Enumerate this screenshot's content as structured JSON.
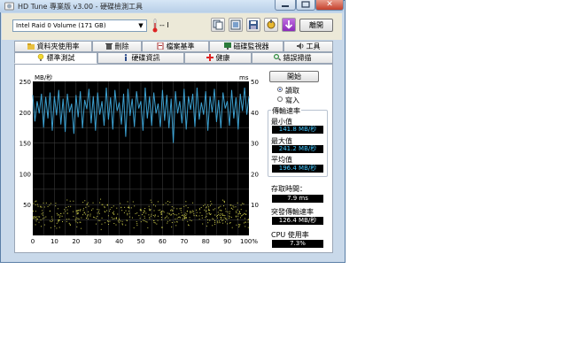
{
  "window": {
    "title": "HD Tune 專業版 v3.00 - 硬碟檢測工具",
    "close_symbol": "✕"
  },
  "toolbar": {
    "drive": "Intel   Raid 0 Volume  (171 GB)",
    "temperature": "-- I",
    "exit_label": "離開"
  },
  "tabs_row1": [
    {
      "label": "資料夾使用率",
      "icon": "folder-icon"
    },
    {
      "label": "刪除",
      "icon": "trash-icon"
    },
    {
      "label": "檔案基準",
      "icon": "file-benchmark-icon"
    },
    {
      "label": "磁碟監視器",
      "icon": "monitor-icon"
    },
    {
      "label": "工具",
      "icon": "speaker-icon"
    }
  ],
  "tabs_row2": [
    {
      "label": "標準測試",
      "icon": "bulb-icon"
    },
    {
      "label": "硬碟資訊",
      "icon": "info-icon"
    },
    {
      "label": "健康",
      "icon": "health-cross-icon"
    },
    {
      "label": "錯誤掃描",
      "icon": "magnifier-icon"
    }
  ],
  "controls": {
    "start_label": "開始",
    "read_label": "讀取",
    "write_label": "寫入",
    "selected": "read"
  },
  "results": {
    "group_title": "傳輸速率",
    "min_label": "最小值",
    "min_value": "141.8 MB/秒",
    "max_label": "最大值",
    "max_value": "241.2 MB/秒",
    "avg_label": "平均值",
    "avg_value": "196.4 MB/秒",
    "access_label": "存取時間：",
    "access_value": "7.9 ms",
    "burst_label": "突發傳輸速率",
    "burst_value": "126.4 MB/秒",
    "cpu_label": "CPU 使用率",
    "cpu_value": "7.3%"
  },
  "colors": {
    "plot_background": "#000000",
    "transfer_line": "#3ca0d0",
    "access_points": "#c8c84a",
    "grid": "#3a3a3a"
  },
  "chart_data": {
    "type": "line",
    "ylabel": "MB/秒",
    "y2label": "ms",
    "ylim": [
      0,
      250
    ],
    "y2lim": [
      0,
      50
    ],
    "yticks": [
      50,
      100,
      150,
      200,
      250
    ],
    "y2ticks": [
      10,
      20,
      30,
      40,
      50
    ],
    "xticks": [
      "0",
      "10",
      "20",
      "30",
      "40",
      "50",
      "60",
      "70",
      "80",
      "90",
      "100%"
    ],
    "grid": true,
    "transfer_rate": {
      "x": [
        0,
        1,
        2,
        3,
        4,
        5,
        6,
        7,
        8,
        9,
        10,
        11,
        12,
        13,
        14,
        15,
        16,
        17,
        18,
        19,
        20,
        21,
        22,
        23,
        24,
        25,
        26,
        27,
        28,
        29,
        30,
        31,
        32,
        33,
        34,
        35,
        36,
        37,
        38,
        39,
        40,
        41,
        42,
        43,
        44,
        45,
        46,
        47,
        48,
        49,
        50,
        51,
        52,
        53,
        54,
        55,
        56,
        57,
        58,
        59,
        60,
        61,
        62,
        63,
        64,
        65,
        66,
        67,
        68,
        69,
        70,
        71,
        72,
        73,
        74,
        75,
        76,
        77,
        78,
        79,
        80,
        81,
        82,
        83,
        84,
        85,
        86,
        87,
        88,
        89,
        90,
        91,
        92,
        93,
        94,
        95,
        96,
        97,
        98,
        99,
        100
      ],
      "values": [
        228,
        185,
        218,
        198,
        230,
        175,
        225,
        190,
        232,
        170,
        226,
        195,
        236,
        180,
        222,
        168,
        230,
        200,
        214,
        165,
        228,
        192,
        234,
        174,
        220,
        205,
        238,
        182,
        226,
        170,
        232,
        196,
        218,
        178,
        240,
        188,
        224,
        172,
        236,
        202,
        216,
        180,
        230,
        160,
        238,
        194,
        222,
        176,
        234,
        206,
        218,
        170,
        240,
        190,
        226,
        178,
        232,
        198,
        214,
        176,
        236,
        186,
        228,
        174,
        222,
        150,
        234,
        198,
        218,
        182,
        238,
        172,
        226,
        204,
        230,
        176,
        240,
        188,
        216,
        196,
        234,
        170,
        226,
        200,
        238,
        184,
        220,
        174,
        232,
        206,
        218,
        178,
        236,
        190,
        224,
        172,
        230,
        202,
        240,
        196,
        226
      ]
    },
    "access_time_ms": {
      "description_range": [
        2,
        12
      ],
      "cluster_center": 7.9
    }
  }
}
